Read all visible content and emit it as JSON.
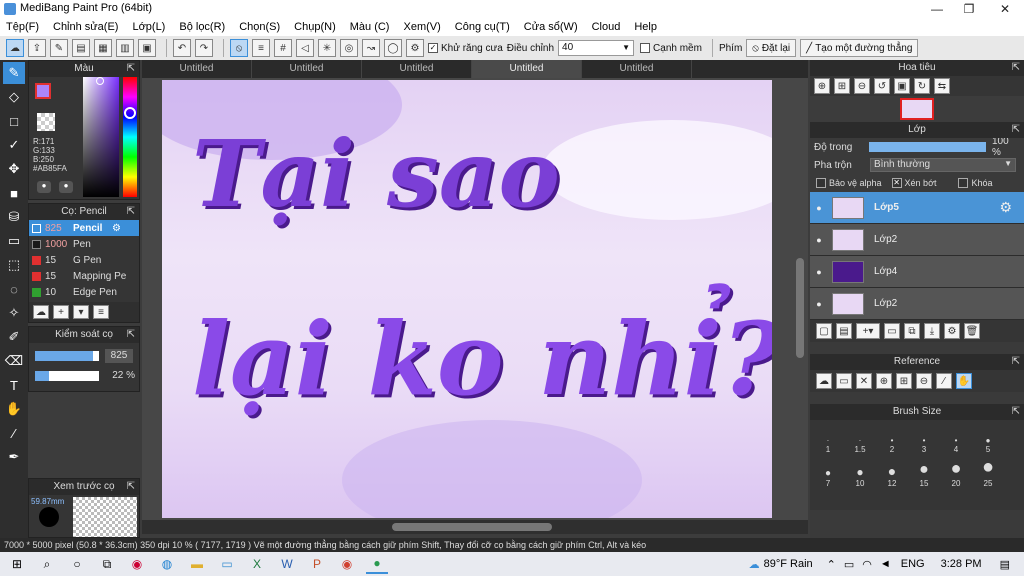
{
  "app": {
    "title": "MediBang Paint Pro (64bit)"
  },
  "window_controls": {
    "minimize": "—",
    "maximize": "❐",
    "close": "✕"
  },
  "menu": [
    "Tệp(F)",
    "Chỉnh sửa(E)",
    "Lớp(L)",
    "Bộ lọc(R)",
    "Chọn(S)",
    "Chụp(N)",
    "Màu (C)",
    "Xem(V)",
    "Công cụ(T)",
    "Cửa sổ(W)",
    "Cloud",
    "Help"
  ],
  "toolbar": {
    "antialias_label": "Khử răng cưa",
    "adjust_label": "Điều chỉnh",
    "adjust_value": "40",
    "soft_edge_label": "Cạnh mềm",
    "key_label": "Phím",
    "reset_label": "Đặt lại",
    "create_line_label": "Tạo một đường thẳng"
  },
  "color_panel": {
    "title": "Màu",
    "r": "R:171",
    "g": "G:133",
    "b": "B:250",
    "hex": "#AB85FA",
    "color": "#AB85FA"
  },
  "brush_panel": {
    "title": "Cọ: Pencil",
    "items": [
      {
        "size": "825",
        "name": "Pencil",
        "color": "#ffffff"
      },
      {
        "size": "1000",
        "name": "Pen",
        "color": "#1a1a1a"
      },
      {
        "size": "15",
        "name": "G Pen",
        "color": "#e03030"
      },
      {
        "size": "15",
        "name": "Mapping Pe",
        "color": "#e03030"
      },
      {
        "size": "10",
        "name": "Edge Pen",
        "color": "#30a030"
      }
    ]
  },
  "brush_control": {
    "title": "Kiểm soát cọ",
    "size_value": "825",
    "opacity_value": "22 %",
    "size_fraction": 0.9,
    "opacity_fraction": 0.22
  },
  "preview_panel": {
    "title": "Xem trước cọ",
    "size": "59.87mm"
  },
  "doc_tabs": [
    "Untitled",
    "Untitled",
    "Untitled",
    "Untitled",
    "Untitled"
  ],
  "canvas": {
    "line1": "Tại sao",
    "line2": "lại ko nhỉ?"
  },
  "navigator": {
    "title": "Hoa tiêu"
  },
  "layers_panel": {
    "title": "Lớp",
    "opacity_label": "Độ trong",
    "opacity_value": "100 %",
    "blend_label": "Pha trộn",
    "blend_value": "Bình thường",
    "protect_alpha": "Bảo vệ alpha",
    "clipping": "Xén bớt",
    "lock": "Khóa",
    "layers": [
      "Lớp5",
      "Lớp2",
      "Lớp4",
      "Lớp2"
    ]
  },
  "reference_panel": {
    "title": "Reference"
  },
  "brush_size_panel": {
    "title": "Brush Size",
    "row1": [
      "1",
      "1.5",
      "2",
      "3",
      "4",
      "5"
    ],
    "row2": [
      "7",
      "10",
      "12",
      "15",
      "20",
      "25"
    ]
  },
  "status": {
    "text": "7000 * 5000 pixel  (50.8 * 36.3cm)  350 dpi  10 %  ( 7177, 1719 )  Vẽ một đường thẳng bằng cách giữ phím Shift, Thay đổi cỡ cọ bằng cách giữ phím Ctrl, Alt và kéo"
  },
  "taskbar": {
    "weather": "89°F Rain",
    "lang": "ENG",
    "time": "3:28 PM"
  }
}
